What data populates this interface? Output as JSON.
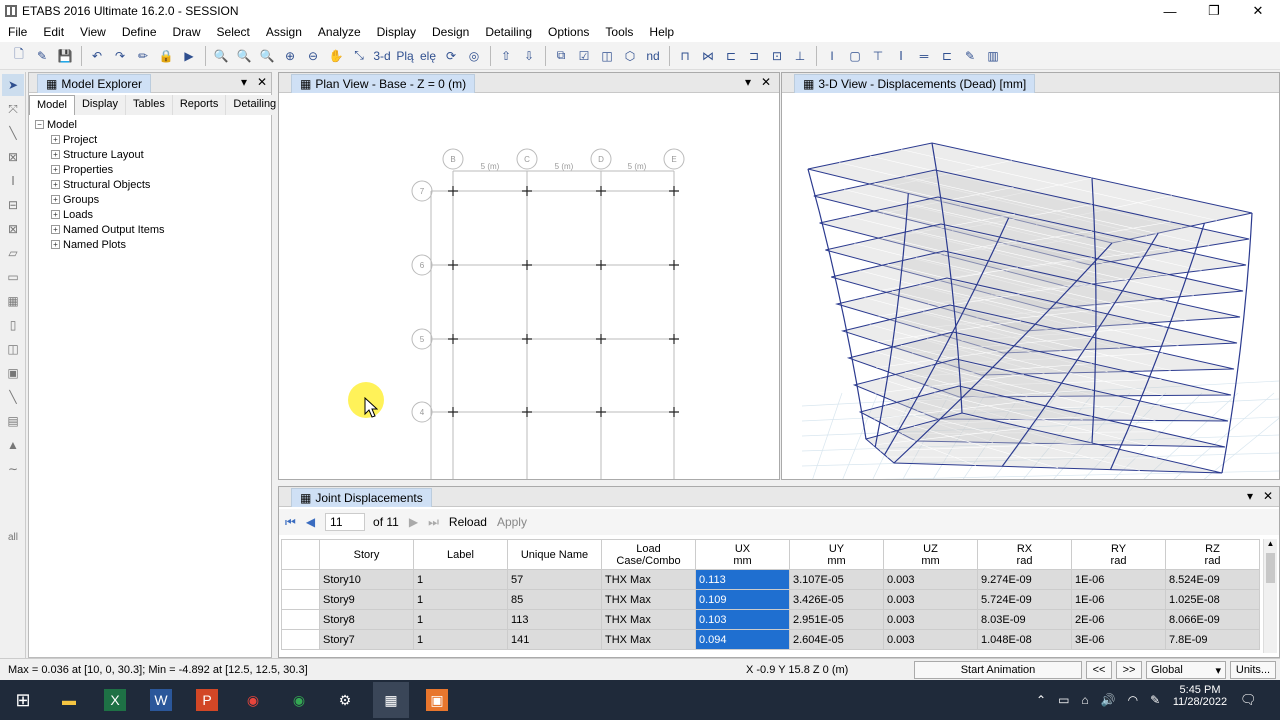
{
  "window": {
    "title": "ETABS 2016 Ultimate 16.2.0 - SESSION",
    "minimize": "—",
    "restore": "❐",
    "close": "✕"
  },
  "menu": [
    "File",
    "Edit",
    "View",
    "Define",
    "Draw",
    "Select",
    "Assign",
    "Analyze",
    "Display",
    "Design",
    "Detailing",
    "Options",
    "Tools",
    "Help"
  ],
  "toolbar": {
    "threed_label": "3-d",
    "plan_label": "Plą",
    "elev_label": "elę",
    "nd_label": "nd"
  },
  "explorer": {
    "title": "Model Explorer",
    "tabs": [
      "Model",
      "Display",
      "Tables",
      "Reports",
      "Detailing"
    ],
    "active_tab": "Model",
    "root": "Model",
    "items": [
      "Project",
      "Structure Layout",
      "Properties",
      "Structural Objects",
      "Groups",
      "Loads",
      "Named Output Items",
      "Named Plots"
    ]
  },
  "plan_view": {
    "title": "Plan View - Base - Z = 0 (m)",
    "grid_cols": [
      "B",
      "C",
      "D",
      "E"
    ],
    "grid_rows": [
      "7",
      "6",
      "5",
      "4"
    ],
    "spacing_label": "5 (m)"
  },
  "view_3d": {
    "title": "3-D View  - Displacements (Dead)  [mm]"
  },
  "table": {
    "title": "Joint Displacements",
    "page": "11",
    "of_label": "of 11",
    "reload": "Reload",
    "apply": "Apply",
    "headers": [
      {
        "top": "Story",
        "bottom": ""
      },
      {
        "top": "Label",
        "bottom": ""
      },
      {
        "top": "Unique Name",
        "bottom": ""
      },
      {
        "top": "Load",
        "bottom": "Case/Combo"
      },
      {
        "top": "UX",
        "bottom": "mm"
      },
      {
        "top": "UY",
        "bottom": "mm"
      },
      {
        "top": "UZ",
        "bottom": "mm"
      },
      {
        "top": "RX",
        "bottom": "rad"
      },
      {
        "top": "RY",
        "bottom": "rad"
      },
      {
        "top": "RZ",
        "bottom": "rad"
      }
    ],
    "rows": [
      [
        "Story10",
        "1",
        "57",
        "THX Max",
        "0.113",
        "3.107E-05",
        "0.003",
        "9.274E-09",
        "1E-06",
        "8.524E-09"
      ],
      [
        "Story9",
        "1",
        "85",
        "THX Max",
        "0.109",
        "3.426E-05",
        "0.003",
        "5.724E-09",
        "1E-06",
        "1.025E-08"
      ],
      [
        "Story8",
        "1",
        "113",
        "THX Max",
        "0.103",
        "2.951E-05",
        "0.003",
        "8.03E-09",
        "2E-06",
        "8.066E-09"
      ],
      [
        "Story7",
        "1",
        "141",
        "THX Max",
        "0.094",
        "2.604E-05",
        "0.003",
        "1.048E-08",
        "3E-06",
        "7.8E-09"
      ]
    ]
  },
  "status": {
    "minmax": "Max = 0.036 at [10, 0, 30.3];  Min = -4.892 at [12.5, 12.5, 30.3]",
    "coords": "X -0.9  Y 15.8  Z 0 (m)",
    "start_animation": "Start Animation",
    "prev": "<<",
    "next": ">>",
    "coord_system": "Global",
    "units": "Units..."
  },
  "lefttools": {
    "all_label": "all"
  },
  "taskbar": {
    "time": "5:45 PM",
    "date": "11/28/2022"
  },
  "colors": {
    "selection": "#1f6fd0",
    "frame": "#2b3a8f",
    "taskbar": "#1f2a3a"
  }
}
